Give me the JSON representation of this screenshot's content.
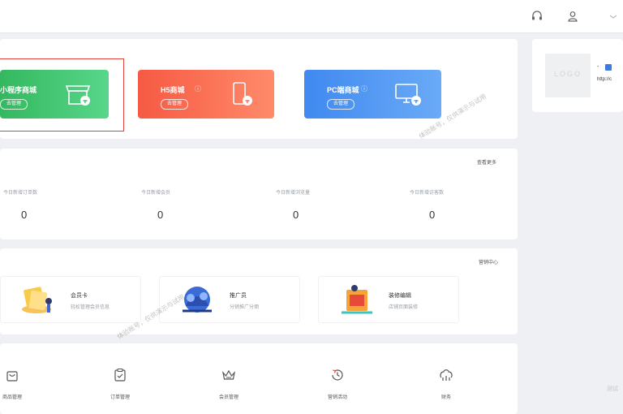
{
  "header": {
    "icons": [
      "headset-icon",
      "user-icon",
      "chevron-down-icon"
    ]
  },
  "shops": [
    {
      "title": "小程序商城",
      "button": "去管理",
      "icon": "store-icon",
      "color": "#3ec46d"
    },
    {
      "title": "H5商城",
      "button": "去管理",
      "icon": "phone-icon",
      "color": "#fa6b51"
    },
    {
      "title": "PC端商城",
      "button": "去管理",
      "icon": "monitor-icon",
      "color": "#4a95f2"
    }
  ],
  "account": {
    "logo_text": "LOGO",
    "mark": "-",
    "url": "http://c"
  },
  "stats": {
    "more": "查看更多",
    "items": [
      {
        "label": "今日新增订单数",
        "value": "0"
      },
      {
        "label": "今日新增会员",
        "value": "0"
      },
      {
        "label": "今日新增浏览量",
        "value": "0"
      },
      {
        "label": "今日新增访客数",
        "value": "0"
      }
    ]
  },
  "features": {
    "more": "营销中心",
    "items": [
      {
        "title": "会员卡",
        "subtitle": "轻松管理会员信息",
        "icon": "membership-card-icon"
      },
      {
        "title": "推广员",
        "subtitle": "分销推广分佣",
        "icon": "promoter-icon"
      },
      {
        "title": "装修编辑",
        "subtitle": "店铺页面装修",
        "icon": "decoration-icon"
      }
    ]
  },
  "tools": [
    {
      "label": "商品管理",
      "icon": "bag-icon"
    },
    {
      "label": "订单管理",
      "icon": "clipboard-icon"
    },
    {
      "label": "会员管理",
      "icon": "crown-icon"
    },
    {
      "label": "营销活动",
      "icon": "clock-icon"
    },
    {
      "label": "财务",
      "icon": "finance-icon"
    }
  ],
  "watermark": "体验账号，仅供演示与试用",
  "corner_text": "测试"
}
